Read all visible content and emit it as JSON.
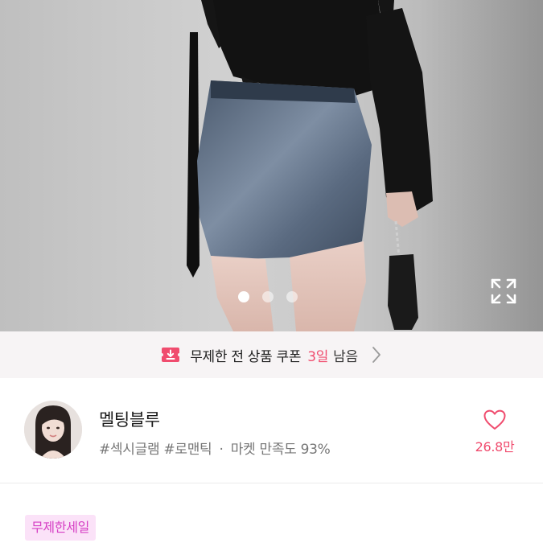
{
  "hero": {
    "dots": [
      {
        "active": true
      },
      {
        "active": false
      },
      {
        "active": false
      }
    ],
    "expand_icon": "expand-arrows-icon"
  },
  "coupon": {
    "icon": "download-coupon-icon",
    "text": "무제한 전 상품 쿠폰",
    "accent": "3일",
    "sub": "남음",
    "chevron_icon": "chevron-right-icon",
    "accent_color": "#f04c6e"
  },
  "seller": {
    "name": "멜팅블루",
    "tag1": "#섹시글램",
    "tag2": "#로맨틱",
    "separator": "·",
    "satisfaction": "마켓 만족도 93%",
    "like_count": "26.8만",
    "like_icon": "heart-outline-icon",
    "like_color": "#f04c6e"
  },
  "badge": {
    "label": "무제한세일",
    "color": "#d63fc4",
    "bg": "#fbe2f8"
  }
}
